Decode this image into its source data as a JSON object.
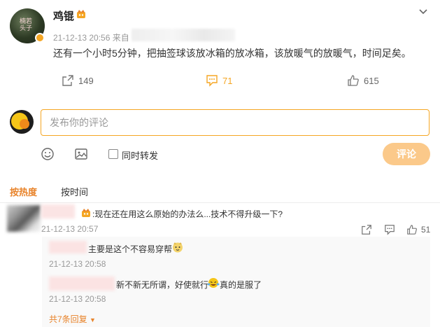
{
  "post": {
    "username": "鸡锟",
    "time": "21-12-13 20:56",
    "source_prefix": "来自",
    "text": "还有一个小时5分钟，把抽签球该放冰箱的放冰箱，该放暖气的放暖气，时间足矣。",
    "forward_count": "149",
    "comment_count": "71",
    "like_count": "615",
    "accent_color": "#f5a623"
  },
  "composer": {
    "placeholder": "发布你的评论",
    "repost_label": "同时转发",
    "submit_label": "评论"
  },
  "tabs": {
    "hot": "按热度",
    "time": "按时间"
  },
  "comments": [
    {
      "text": ":现在还在用这么原始的办法么...技术不得升级一下?",
      "time": "21-12-13 20:57",
      "like_count": "51",
      "replies": [
        {
          "text": "主要是这个不容易穿帮",
          "time": "21-12-13 20:58"
        },
        {
          "text": "新不新无所谓，好使就行",
          "text_after": "真的是服了",
          "time": "21-12-13 20:58"
        }
      ],
      "more_replies_label": "共7条回复"
    }
  ]
}
